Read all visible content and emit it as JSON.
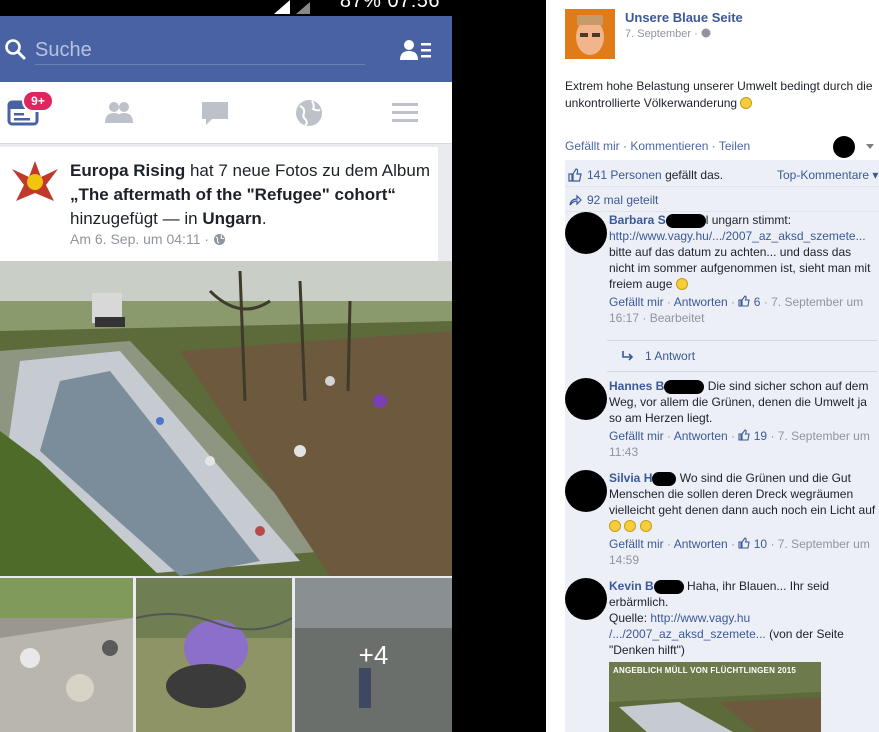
{
  "phone": {
    "status": {
      "text": "87%  07:56"
    },
    "search": {
      "placeholder": "Suche"
    },
    "nav": {
      "badge": "9+"
    },
    "post": {
      "page_name": "Europa Rising",
      "headline_middle": " hat 7 neue Fotos zu dem Album ",
      "album_title": "„The aftermath of the \"Refugee\" cohort“",
      "headline_tail": " hinzugefügt — in ",
      "location": "Ungarn",
      "location_end": ".",
      "meta": "Am 6. Sep. um 04:11 · ",
      "more_photos": "+4"
    }
  },
  "desktop": {
    "page_name": "Unsere Blaue Seite",
    "post_date": "7. September · ",
    "post_text": "Extrem hohe Belastung unserer Umwelt bedingt durch die unkontrollierte Völkerwanderung",
    "actions": {
      "like": "Gefällt mir",
      "comment": "Kommentieren",
      "share": "Teilen",
      "sep": " · "
    },
    "likes": {
      "count": "141 Personen",
      "suffix": " gefällt das.",
      "top_comments": "Top-Kommentare"
    },
    "shares": "92 mal geteilt",
    "comments": [
      {
        "name": "Barbara S",
        "text_prefix": "l ungarn stimmt:",
        "url": "http://www.vagy.hu/.../2007_az_aksd_szemete...",
        "text": "bitte auf das datum zu achten... und dass das nicht im sommer aufgenommen ist, sieht man mit freiem auge",
        "like_label": "Gefällt mir",
        "reply_label": "Antworten",
        "likes": "6",
        "time": "7. September um 16:17",
        "edited": "Bearbeitet"
      },
      {
        "name": "Hannes B",
        "text": "Die sind sicher schon auf dem Weg, vor allem die Grünen, denen die Umwelt ja so am Herzen liegt.",
        "like_label": "Gefällt mir",
        "reply_label": "Antworten",
        "likes": "19",
        "time": "7. September um 11:43"
      },
      {
        "name": "Silvia H",
        "text": "Wo sind die Grünen und die Gut Menschen die sollen deren Dreck wegräumen vielleicht geht denen dann auch noch ein Licht auf",
        "like_label": "Gefällt mir",
        "reply_label": "Antworten",
        "likes": "10",
        "time": "7. September um 14:59"
      },
      {
        "name": "Kevin B",
        "text": "Haha, ihr Blauen... Ihr seid erbärmlich.",
        "source_label": "Quelle: ",
        "url": "http://www.vagy.hu /.../2007_az_aksd_szemete...",
        "source_suffix": " (von der Seite \"Denken hilft\")"
      }
    ],
    "reply_count": "1 Antwort",
    "preview_label": "ANGEBLICH MÜLL VON FLÜCHTLINGEN 2015"
  },
  "colors": {
    "fb_blue": "#4862a3",
    "link": "#3b5998",
    "badge": "#e0245e"
  }
}
